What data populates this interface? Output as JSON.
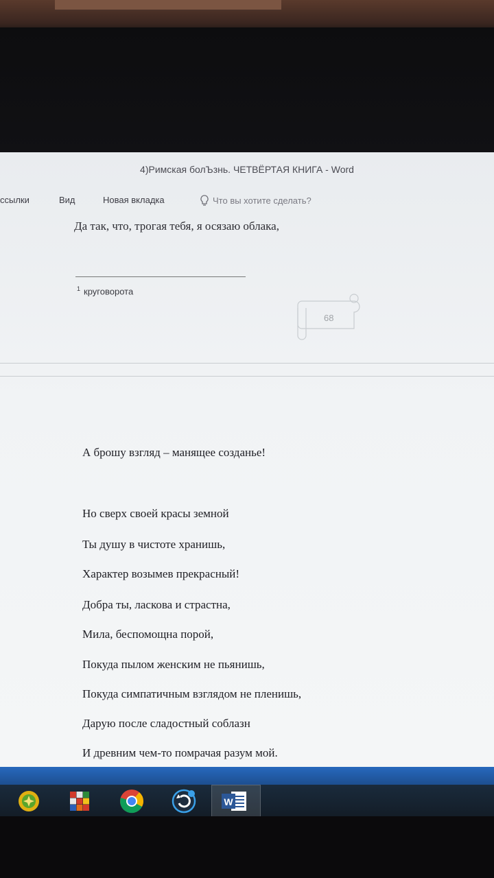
{
  "window": {
    "title": "4)Римская болЪзнь. ЧЕТВЁРТАЯ КНИГА  -  Word"
  },
  "menu": {
    "items": [
      "ссылки",
      "Вид",
      "Новая вкладка"
    ],
    "tell_me": "Что вы хотите сделать?"
  },
  "page1": {
    "line": "Да так, что, трогая тебя, я осязаю облака,",
    "footnote_mark": "1",
    "footnote_text": "круговорота",
    "page_number": "68"
  },
  "page2": {
    "lines": [
      "А брошу взгляд – манящее созданье!",
      "Но сверх своей красы земной",
      "Ты душу в чистоте хранишь,",
      "Характер возымев прекрасный!",
      "Добра ты, ласкова и страстна,",
      "Мила, беспомощна порой,",
      "Покуда пылом женским не пьянишь,",
      "Покуда симпатичным взглядом не пленишь,",
      "Дарую после сладостный соблазн",
      "И древним чем-то помрачая разум мой."
    ]
  },
  "taskbar": {
    "icons": [
      "app-green-icon",
      "cube-app-icon",
      "chrome-icon",
      "sync-app-icon",
      "word-icon"
    ],
    "word_icon_letter": "W"
  },
  "colors": {
    "taskbar": "#1e56a3",
    "word_blue": "#2b5797"
  }
}
